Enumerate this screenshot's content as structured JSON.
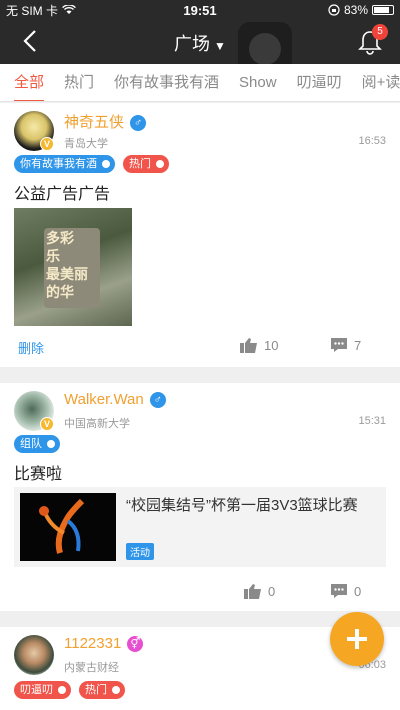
{
  "status": {
    "carrier": "无 SIM 卡",
    "time": "19:51",
    "battery": "83%",
    "battery_level": 0.83
  },
  "nav": {
    "title": "广场",
    "notification_count": "5"
  },
  "tabs": [
    "全部",
    "热门",
    "你有故事我有酒",
    "Show",
    "叨逼叨",
    "阅+读"
  ],
  "posts": [
    {
      "user": "神奇五侠",
      "gender": "♂",
      "school": "青岛大学",
      "time": "16:53",
      "tags": [
        "你有故事我有酒",
        "热门"
      ],
      "text": "公益广告广告",
      "photo_text": [
        "多彩",
        "乐",
        "最美丽",
        "的华"
      ],
      "delete_label": "删除",
      "likes": "10",
      "comments": "7"
    },
    {
      "user": "Walker.Wan",
      "gender": "♂",
      "school": "中国高新大学",
      "time": "15:31",
      "tags": [
        "组队"
      ],
      "text": "比赛啦",
      "activity_title": "“校园集结号”杯第一届3V3篮球比赛",
      "activity_badge": "活动",
      "likes": "0",
      "comments": "0"
    },
    {
      "user": "1122331",
      "gender": "⚥",
      "school": "内蒙古财经",
      "time": "06:03",
      "tags": [
        "叨逼叨",
        "热门"
      ]
    }
  ],
  "colors": {
    "accent": "#f05a3e",
    "username": "#f0a030",
    "blue": "#2f95e8",
    "fab": "#f5a623"
  }
}
